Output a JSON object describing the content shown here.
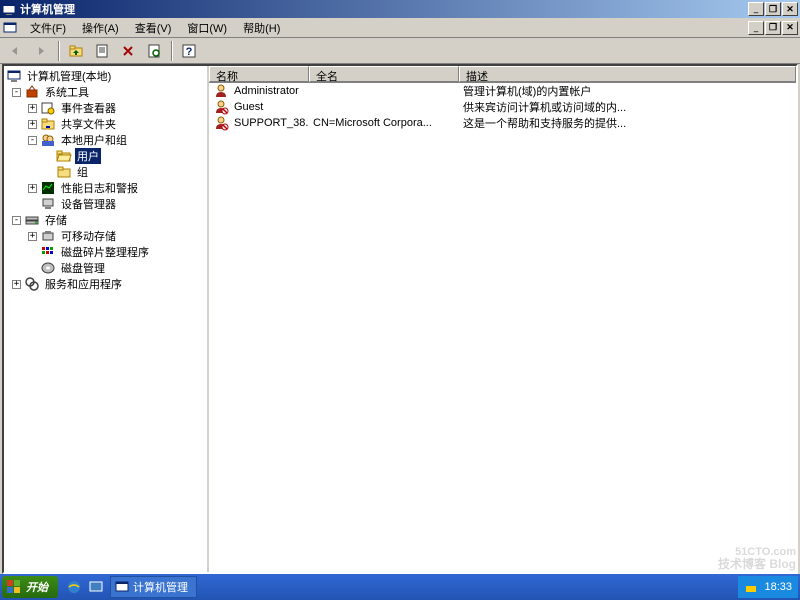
{
  "window": {
    "title": "计算机管理",
    "min": "_",
    "restore": "❐",
    "close": "✕",
    "inner_min": "_",
    "inner_restore": "❐",
    "inner_close": "✕"
  },
  "menu": {
    "file": "文件(F)",
    "action": "操作(A)",
    "view": "查看(V)",
    "window": "窗口(W)",
    "help": "帮助(H)"
  },
  "tree": {
    "root": "计算机管理(本地)",
    "sys_tools": "系统工具",
    "event_viewer": "事件查看器",
    "shared_folders": "共享文件夹",
    "local_users": "本地用户和组",
    "users": "用户",
    "groups": "组",
    "perf_logs": "性能日志和警报",
    "dev_mgr": "设备管理器",
    "storage": "存储",
    "removable": "可移动存储",
    "defrag": "磁盘碎片整理程序",
    "diskmgmt": "磁盘管理",
    "services_apps": "服务和应用程序"
  },
  "columns": {
    "name": "名称",
    "fullname": "全名",
    "desc": "描述"
  },
  "users": [
    {
      "name": "Administrator",
      "fullname": "",
      "desc": "管理计算机(域)的内置帐户"
    },
    {
      "name": "Guest",
      "fullname": "",
      "desc": "供来宾访问计算机或访问域的内..."
    },
    {
      "name": "SUPPORT_38...",
      "fullname": "CN=Microsoft Corpora...",
      "desc": "这是一个帮助和支持服务的提供..."
    }
  ],
  "taskbar": {
    "start": "开始",
    "task": "计算机管理",
    "time": "18:33"
  },
  "watermark": {
    "l1": "51CTO.com",
    "l2": "技术博客   Blog"
  }
}
